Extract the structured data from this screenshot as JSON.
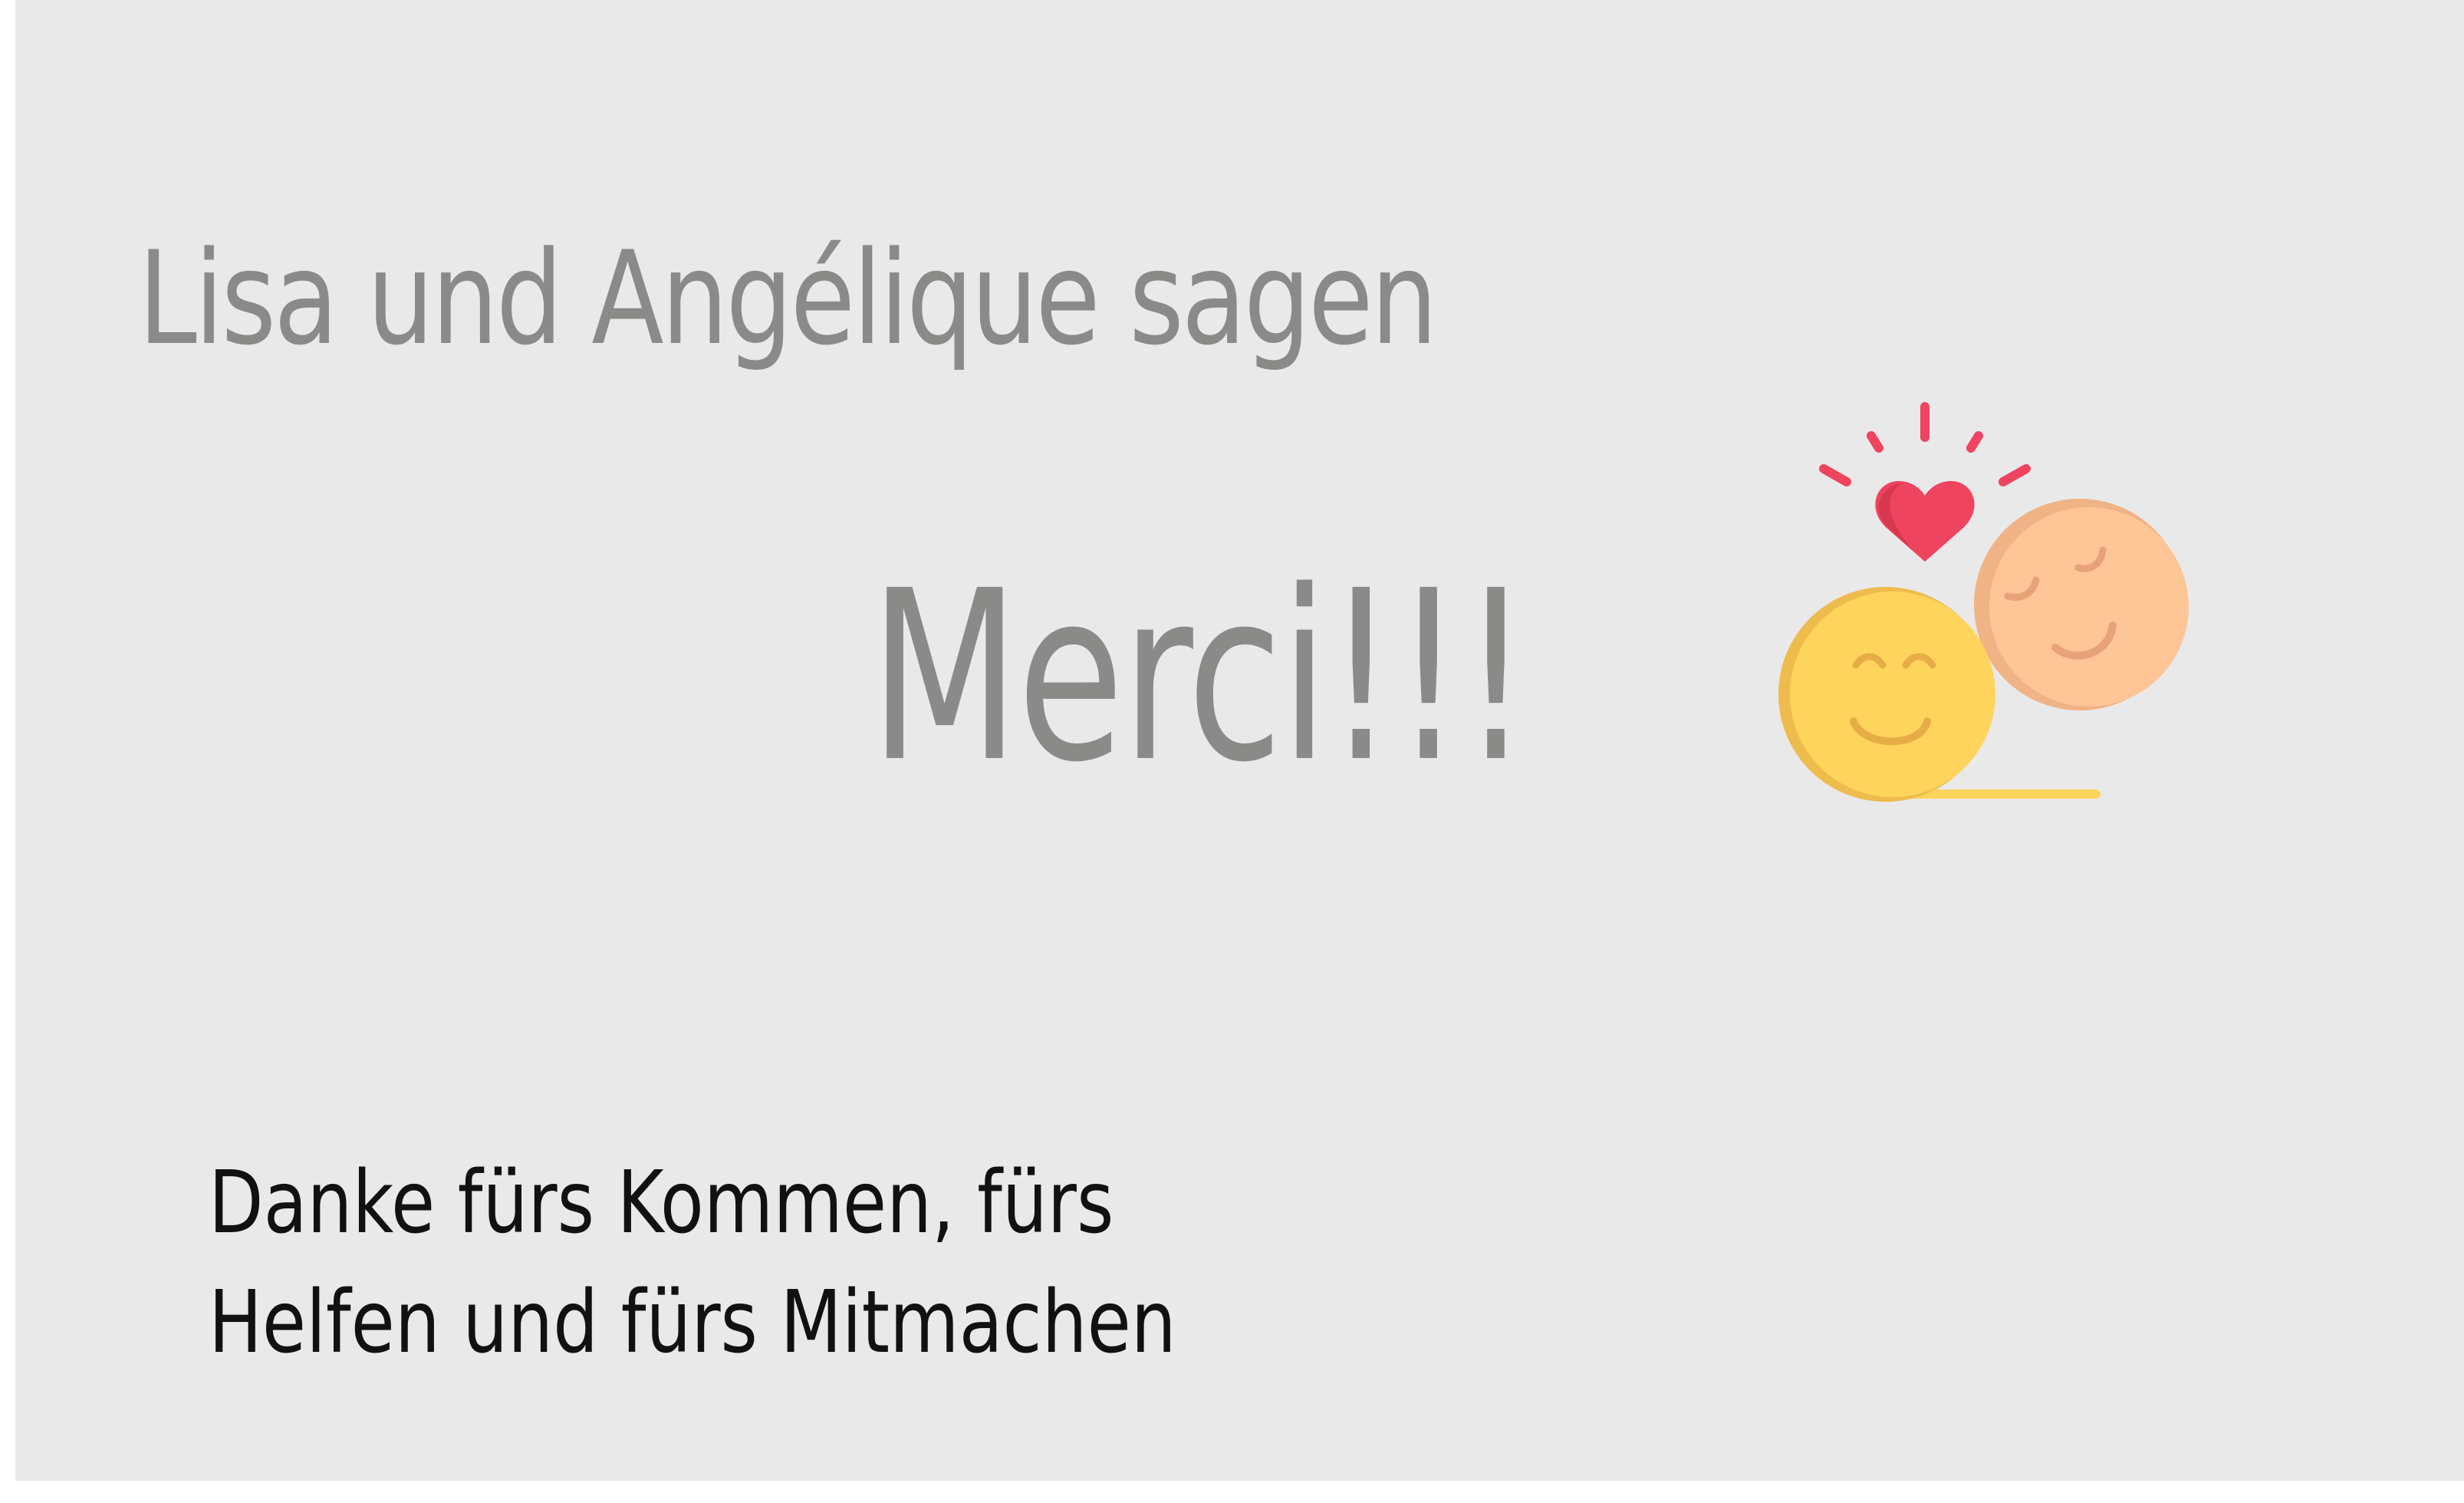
{
  "slide": {
    "headline": "Lisa und Angélique sagen",
    "title": "Merci!!!",
    "thanks_line_1": "Danke fürs Kommen, fürs",
    "thanks_line_2": "Helfen und fürs Mitmachen"
  },
  "illustration": {
    "icon": "couple-smileys-with-heart-icon",
    "colors": {
      "heart": "#ef4460",
      "yellow_face": "#ffd45c",
      "peach_face": "#fec597",
      "background": "#e9e9e9",
      "text": "#8a8a89"
    }
  }
}
